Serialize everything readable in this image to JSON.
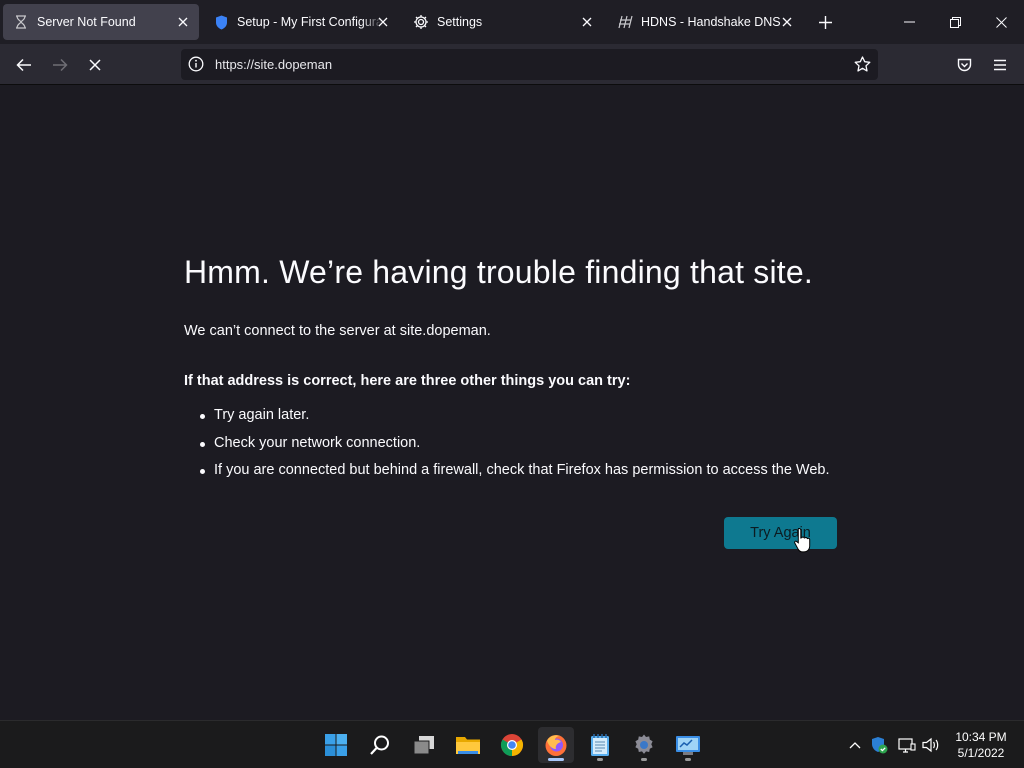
{
  "tabs": [
    {
      "label": "Server Not Found",
      "active": true,
      "icon": "hourglass-icon"
    },
    {
      "label": "Setup - My First Configurati",
      "active": false,
      "icon": "shield-icon"
    },
    {
      "label": "Settings",
      "active": false,
      "icon": "gear-icon"
    },
    {
      "label": "HDNS - Handshake DNS",
      "active": false,
      "icon": "hdns-logo-icon"
    }
  ],
  "navbar": {
    "url": "https://site.dopeman"
  },
  "error_page": {
    "title": "Hmm. We’re having trouble finding that site.",
    "description": "We can’t connect to the server at site.dopeman.",
    "subtitle": "If that address is correct, here are three other things you can try:",
    "suggestions": [
      "Try again later.",
      "Check your network connection.",
      "If you are connected but behind a firewall, check that Firefox has permission to access the Web."
    ],
    "try_again_label": "Try Again"
  },
  "taskbar": {
    "apps": [
      "start-icon",
      "search-icon",
      "task-view-icon",
      "file-explorer-icon",
      "chrome-icon",
      "firefox-icon",
      "notepad-icon",
      "settings-icon",
      "control-panel-icon"
    ],
    "clock": {
      "time": "10:34 PM",
      "date": "5/1/2022"
    }
  },
  "colors": {
    "accent": "#0e7990",
    "page_bg": "#1c1b22",
    "toolbar_bg": "#2b2a33"
  }
}
